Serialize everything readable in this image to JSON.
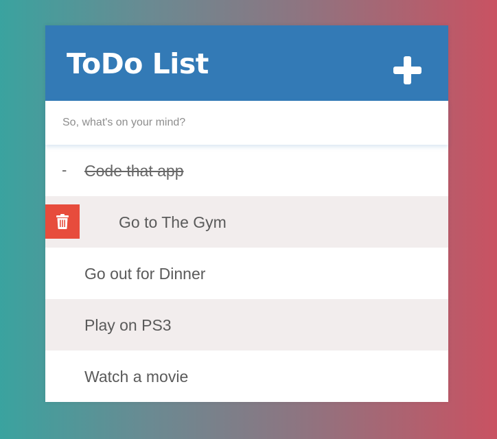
{
  "header": {
    "title": "ToDo List",
    "add_icon": "plus-icon"
  },
  "input": {
    "placeholder": "So, what's on your mind?",
    "value": ""
  },
  "todos": [
    {
      "text": "Code that app",
      "completed": true,
      "marker": "-"
    },
    {
      "text": "Go to The Gym",
      "completed": false,
      "delete_icon": "trash-icon"
    },
    {
      "text": "Go out for Dinner",
      "completed": false
    },
    {
      "text": "Play on PS3",
      "completed": false
    },
    {
      "text": "Watch a movie",
      "completed": false
    }
  ],
  "colors": {
    "header": "#337ab6",
    "delete": "#e74c3c",
    "row_alt": "#f2eded",
    "gradient_left": "#3aa39f",
    "gradient_right": "#c95262"
  }
}
